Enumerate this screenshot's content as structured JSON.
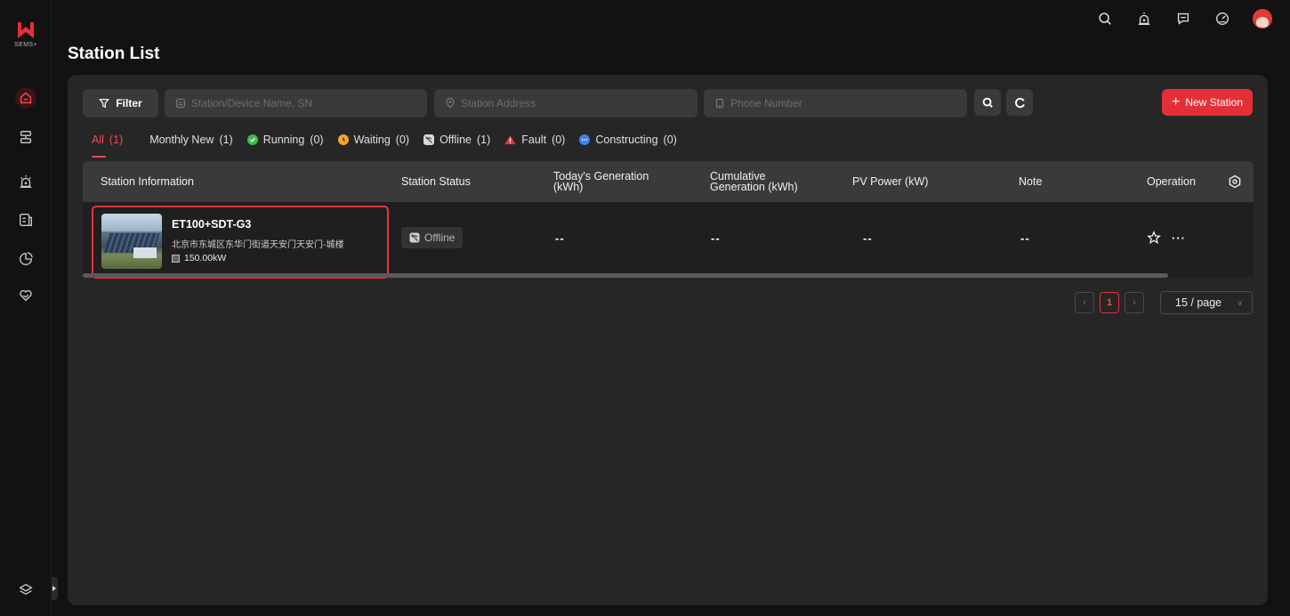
{
  "brand": {
    "sub": "SEMS+",
    "accent": "#e52f36"
  },
  "header": {
    "title": "Station List"
  },
  "toolbar": {
    "filter_label": "Filter",
    "station_placeholder": "Station/Device Name, SN",
    "address_placeholder": "Station Address",
    "phone_placeholder": "Phone Number",
    "new_station_label": "New Station"
  },
  "tabs": [
    {
      "label": "All",
      "count": "(1)"
    },
    {
      "label": "Monthly New",
      "count": "(1)"
    },
    {
      "label": "Running",
      "count": "(0)"
    },
    {
      "label": "Waiting",
      "count": "(0)"
    },
    {
      "label": "Offline",
      "count": "(1)"
    },
    {
      "label": "Fault",
      "count": "(0)"
    },
    {
      "label": "Constructing",
      "count": "(0)"
    }
  ],
  "table": {
    "headers": {
      "info": "Station Information",
      "status": "Station Status",
      "today_1": "Today's Generation",
      "today_2": "(kWh)",
      "cum_1": "Cumulative",
      "cum_2": "Generation (kWh)",
      "pv": "PV Power (kW)",
      "note": "Note",
      "op": "Operation"
    },
    "rows": [
      {
        "name": "ET100+SDT-G3",
        "address": "北京市东城区东华门街道天安门天安门-城楼",
        "capacity": "150.00kW",
        "status": "Offline",
        "today": "--",
        "cumulative": "--",
        "pv": "--",
        "note": "--",
        "more": "···"
      }
    ]
  },
  "pagination": {
    "current": "1",
    "page_size": "15 / page"
  }
}
